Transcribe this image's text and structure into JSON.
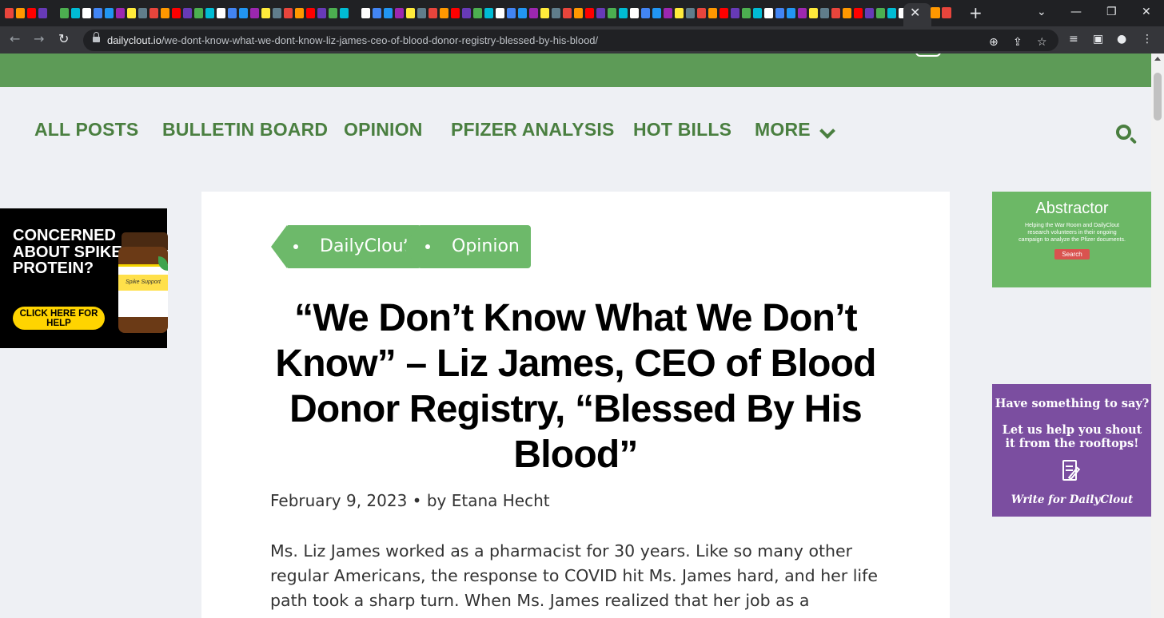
{
  "browser": {
    "active_tab_close": "✕",
    "new_tab": "+",
    "window_controls": {
      "dropdown": "⌄",
      "minimize": "—",
      "restore": "❐",
      "close": "✕"
    },
    "url_host": "dailyclout.io",
    "url_path": "/we-dont-know-what-we-dont-know-liz-james-ceo-of-blood-donor-registry-blessed-by-his-blood/",
    "nav": {
      "back": "←",
      "forward": "→",
      "reload": "↻"
    },
    "toolbar_icons": [
      "zoom-icon",
      "share-icon",
      "bookmark-star-icon",
      "media-icon",
      "side-panel-icon",
      "profile-icon",
      "menu-icon"
    ],
    "favicon_colors": [
      "#e8453c",
      "#4285f4",
      "#ff0000",
      "#9c27b0",
      "#4caf50",
      "#607d8b",
      "#ffffff",
      "#ff9800",
      "#2196f3",
      "#673ab7",
      "#ffeb3b",
      "#00bcd4"
    ]
  },
  "site": {
    "nav": [
      "ALL POSTS",
      "BULLETIN BOARD",
      "OPINION",
      "PFIZER ANALYSIS",
      "HOT BILLS",
      "MORE"
    ],
    "accent": "#4a7f40",
    "header_green": "#5d9b57"
  },
  "ad_left": {
    "headline": "CONCERNED ABOUT SPIKE PROTEIN?",
    "cta": "CLICK HERE FOR HELP",
    "product_label": "Spike Support"
  },
  "article": {
    "tags": [
      "DailyClout",
      "Opinion"
    ],
    "title": "“We Don’t Know What We Don’t Know” – Liz James, CEO of Blood Donor Registry, “Blessed By His Blood”",
    "byline": "February 9, 2023 • by Etana Hecht",
    "body": "Ms. Liz James worked as a pharmacist for 30 years. Like so many other regular Americans, the response to COVID hit Ms. James hard, and her life path took a sharp turn. When Ms. James realized that her job as a"
  },
  "abstractor": {
    "title": "Abstractor",
    "text": "Helping the War Room and DailyClout research volunteers in their ongoing campaign to analyze the Pfizer documents.",
    "button": "Search"
  },
  "write_widget": {
    "question": "Have something to say?",
    "sub": "Let us help you shout it from the rooftops!",
    "link": "Write for DailyClout"
  }
}
